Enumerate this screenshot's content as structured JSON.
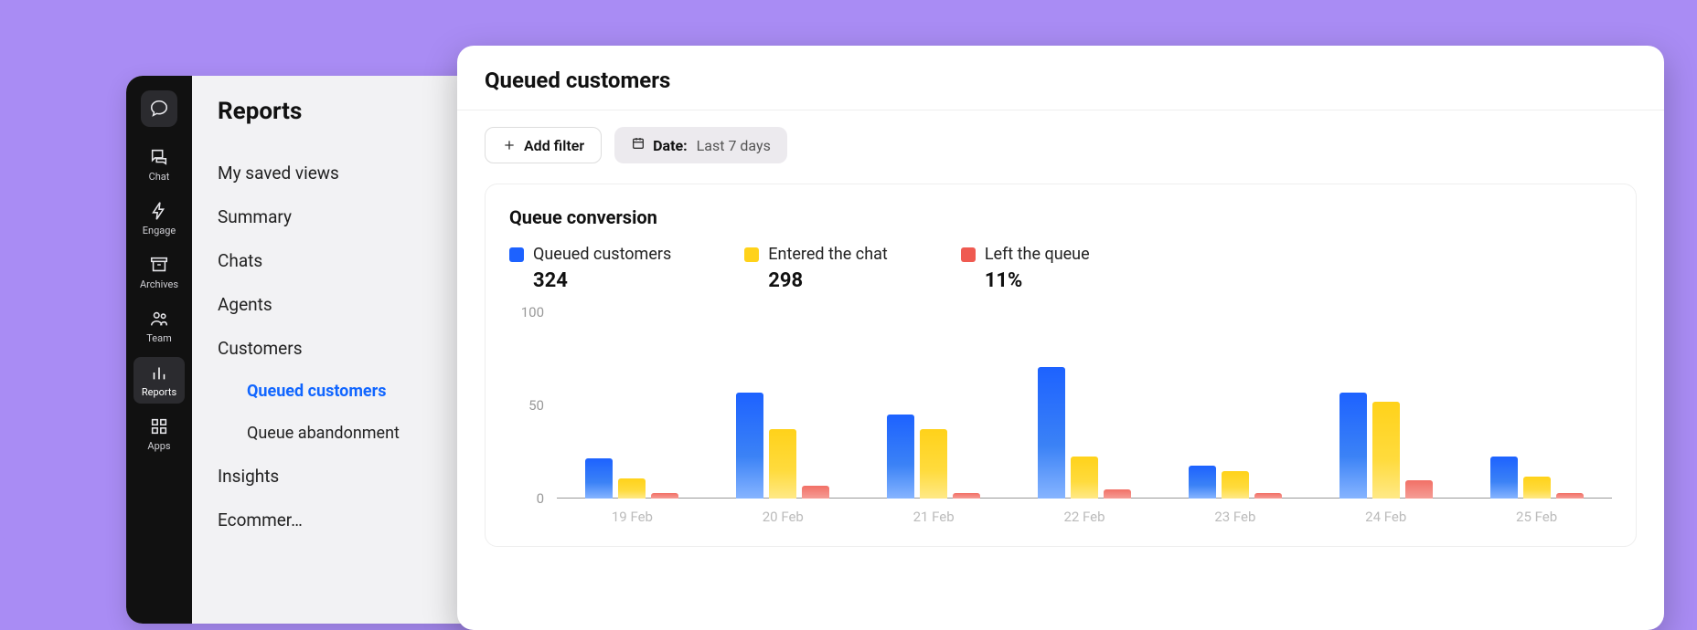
{
  "nav": {
    "items": [
      {
        "id": "logo",
        "label": "",
        "icon": "bubble"
      },
      {
        "id": "chat",
        "label": "Chat",
        "icon": "chat"
      },
      {
        "id": "engage",
        "label": "Engage",
        "icon": "bolt"
      },
      {
        "id": "archives",
        "label": "Archives",
        "icon": "archive"
      },
      {
        "id": "team",
        "label": "Team",
        "icon": "team"
      },
      {
        "id": "reports",
        "label": "Reports",
        "icon": "bars",
        "active": true
      },
      {
        "id": "apps",
        "label": "Apps",
        "icon": "grid"
      }
    ]
  },
  "panel": {
    "title": "Reports",
    "saved_views_label": "My saved views",
    "sections": [
      {
        "label": "Summary",
        "expandable": true
      },
      {
        "label": "Chats",
        "expandable": true
      },
      {
        "label": "Agents",
        "expandable": true
      },
      {
        "label": "Customers",
        "expandable": true,
        "expanded": true,
        "children": [
          {
            "label": "Queued customers",
            "active": true
          },
          {
            "label": "Queue abandonment"
          }
        ]
      },
      {
        "label": "Insights",
        "expandable": true
      },
      {
        "label": "Ecommer…",
        "expandable": true
      }
    ]
  },
  "report": {
    "title": "Queued customers",
    "add_filter_label": "Add filter",
    "date_filter_prefix": "Date:",
    "date_filter_value": "Last 7 days",
    "chart_title": "Queue conversion",
    "legend": [
      {
        "label": "Queued customers",
        "value": "324",
        "color": "#1d62ff"
      },
      {
        "label": "Entered the chat",
        "value": "298",
        "color": "#ffd21a"
      },
      {
        "label": "Left the queue",
        "value": "11%",
        "color": "#ef5a51"
      }
    ]
  },
  "chart_data": {
    "type": "bar",
    "title": "Queue conversion",
    "ylabel": "",
    "ylim": [
      0,
      100
    ],
    "yticks": [
      0,
      50,
      100
    ],
    "categories": [
      "19 Feb",
      "20 Feb",
      "21 Feb",
      "22 Feb",
      "23 Feb",
      "24 Feb",
      "25 Feb"
    ],
    "series": [
      {
        "name": "Queued customers",
        "color": "#1d62ff",
        "values": [
          22,
          58,
          46,
          72,
          18,
          58,
          23
        ]
      },
      {
        "name": "Entered the chat",
        "color": "#ffd21a",
        "values": [
          11,
          38,
          38,
          23,
          15,
          53,
          12
        ]
      },
      {
        "name": "Left the queue",
        "color": "#ef5a51",
        "values": [
          3,
          7,
          3,
          5,
          3,
          10,
          3
        ]
      }
    ]
  }
}
